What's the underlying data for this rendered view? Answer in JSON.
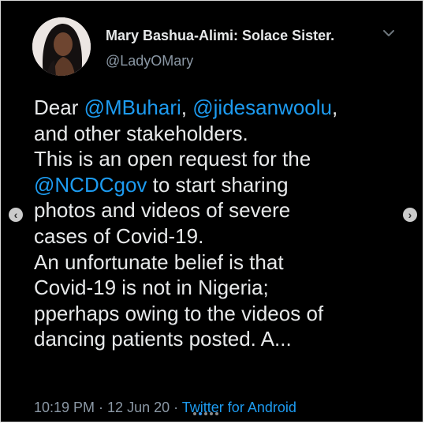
{
  "user": {
    "display_name": "Mary Bashua-Alimi: Solace Sister.",
    "handle": "@LadyOMary"
  },
  "tweet": {
    "lines": [
      [
        {
          "t": "Dear ",
          "m": false
        },
        {
          "t": "@MBuhari",
          "m": true
        },
        {
          "t": ", ",
          "m": false
        },
        {
          "t": "@jidesanwoolu",
          "m": true
        },
        {
          "t": ",",
          "m": false
        }
      ],
      [
        {
          "t": "and other stakeholders.",
          "m": false
        }
      ],
      [
        {
          "t": "This is an open request for the",
          "m": false
        }
      ],
      [
        {
          "t": "@NCDCgov",
          "m": true
        },
        {
          "t": " to start sharing",
          "m": false
        }
      ],
      [
        {
          "t": "photos and videos of severe",
          "m": false
        }
      ],
      [
        {
          "t": "cases of Covid-19.",
          "m": false
        }
      ],
      [
        {
          "t": "An unfortunate belief is that",
          "m": false
        }
      ],
      [
        {
          "t": "Covid-19 is not in Nigeria;",
          "m": false
        }
      ],
      [
        {
          "t": "pperhaps owing to the videos of",
          "m": false
        }
      ],
      [
        {
          "t": "dancing patients posted. A...",
          "m": false
        }
      ]
    ],
    "time": "10:19 PM",
    "separator": " · ",
    "date": "12 Jun 20",
    "source": "Twitter for Android"
  },
  "carousel": {
    "prev_icon": "chevron-left-icon",
    "next_icon": "chevron-right-icon",
    "prev_glyph": "‹",
    "next_glyph": "›",
    "slide_count": 5,
    "active_index": 1
  },
  "colors": {
    "background": "#000000",
    "text": "#e7e9ea",
    "secondary": "#8b98a5",
    "link": "#1d9bf0"
  }
}
